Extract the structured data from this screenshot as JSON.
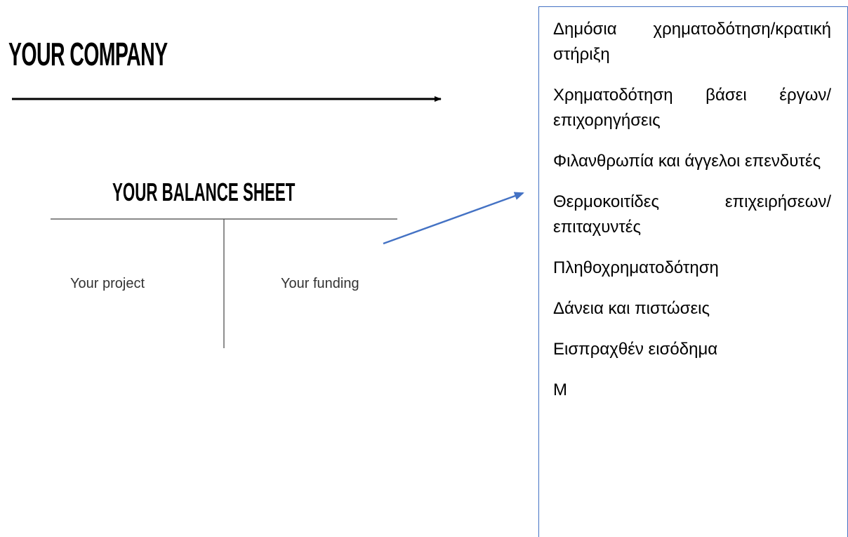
{
  "header": {
    "company": "YOUR COMPANY"
  },
  "balance_sheet": {
    "title": "YOUR BALANCE SHEET",
    "left_column": "Your project",
    "right_column": "Your funding"
  },
  "funding_sources": [
    "Δημόσια χρηματοδότηση/κρατική στήριξη",
    "Χρηματοδότηση βάσει έργων/επιχορηγήσεις",
    "Φιλανθρωπία και άγγελοι επενδυτές",
    "Θερμοκοιτίδες επιχειρήσεων/επιταχυντές",
    "Πληθοχρηματοδότηση",
    "Δάνεια και πιστώσεις",
    "Εισπραχθέν εισόδημα",
    "Μ"
  ],
  "colors": {
    "connector_arrow": "#4472c4",
    "box_border": "#4472c4",
    "timeline_arrow": "#000000"
  }
}
